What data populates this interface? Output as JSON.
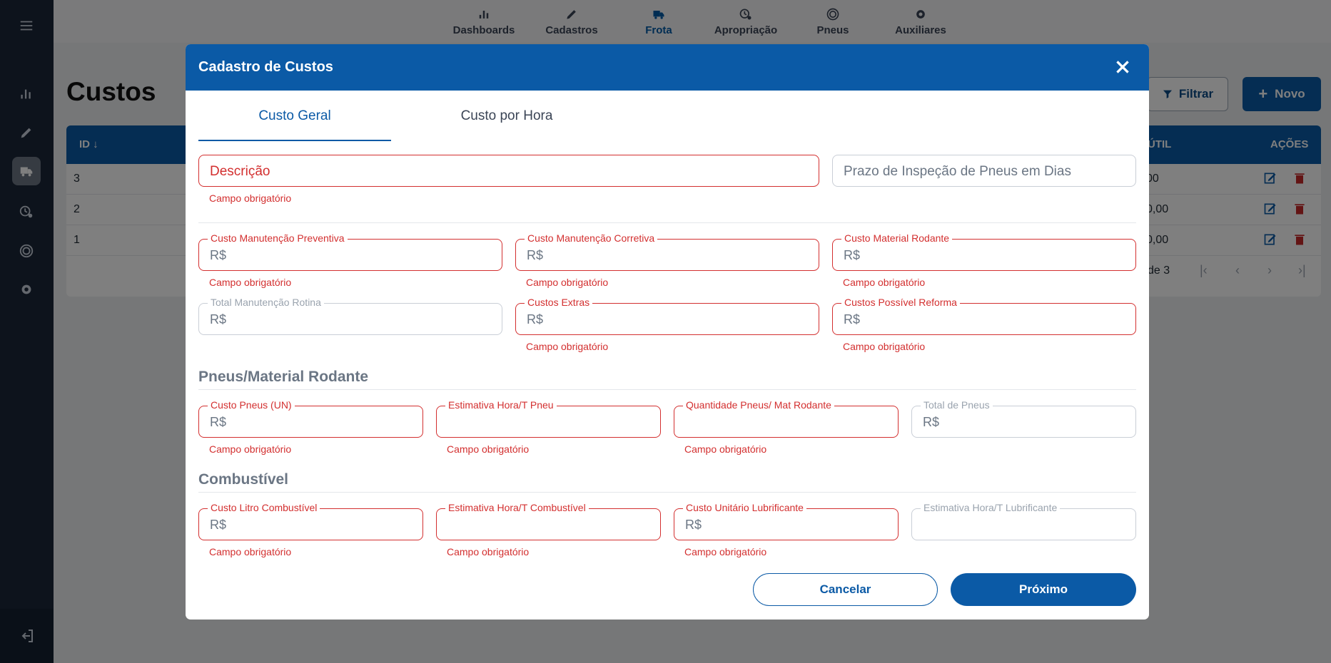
{
  "topnav": {
    "items": [
      {
        "label": "Dashboards",
        "icon": "bar-chart-icon"
      },
      {
        "label": "Cadastros",
        "icon": "pencil-icon"
      },
      {
        "label": "Frota",
        "icon": "truck-icon"
      },
      {
        "label": "Apropriação",
        "icon": "history-gear-icon"
      },
      {
        "label": "Pneus",
        "icon": "tire-icon"
      },
      {
        "label": "Auxiliares",
        "icon": "gear-icon"
      }
    ],
    "active": "Frota"
  },
  "page": {
    "title": "Custos",
    "filter_label": "Filtrar",
    "new_label": "Novo",
    "table": {
      "headers": {
        "id": "ID",
        "util": "ÚTIL",
        "actions": "AÇÕES"
      },
      "rows": [
        {
          "id": "3",
          "util": "00"
        },
        {
          "id": "2",
          "util": "0,00"
        },
        {
          "id": "1",
          "util": "0,00"
        }
      ],
      "pager_text": "de 3"
    }
  },
  "modal": {
    "title": "Cadastro de Custos",
    "tabs": [
      "Custo Geral",
      "Custo por Hora"
    ],
    "descricao_placeholder": "Descrição",
    "prazo_placeholder": "Prazo de Inspeção de Pneus em Dias",
    "error_text": "Campo obrigatório",
    "currency": "R$",
    "row1": {
      "preventiva": "Custo Manutenção Preventiva",
      "corretiva": "Custo Manutenção Corretiva",
      "rodante": "Custo Material Rodante"
    },
    "row2": {
      "rotina": "Total Manutenção Rotina",
      "extras": "Custos Extras",
      "reforma": "Custos Possível Reforma"
    },
    "section_pneus": "Pneus/Material Rodante",
    "pneus": {
      "custo": "Custo Pneus (UN)",
      "estimativa": "Estimativa Hora/T Pneu",
      "quantidade": "Quantidade Pneus/ Mat Rodante",
      "total": "Total de Pneus"
    },
    "section_combustivel": "Combustível",
    "combustivel": {
      "litro": "Custo Litro Combustível",
      "estimativa": "Estimativa Hora/T Combustível",
      "lubrificante": "Custo Unitário Lubrificante",
      "estimativa_lub": "Estimativa Hora/T Lubrificante"
    },
    "cancel_label": "Cancelar",
    "next_label": "Próximo"
  }
}
